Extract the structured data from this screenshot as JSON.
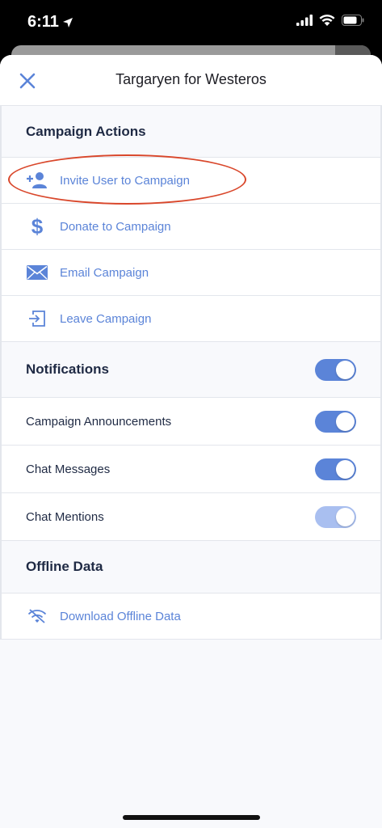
{
  "status_bar": {
    "time": "6:11",
    "location_icon": "location-arrow-icon",
    "signal_icon": "cellular-signal-icon",
    "wifi_icon": "wifi-icon",
    "battery_icon": "battery-icon"
  },
  "nav": {
    "title": "Targaryen for Westeros",
    "close_icon": "close-icon"
  },
  "campaign_actions": {
    "header": "Campaign Actions",
    "items": [
      {
        "label": "Invite User to Campaign",
        "icon": "add-user-icon"
      },
      {
        "label": "Donate to Campaign",
        "icon": "dollar-icon"
      },
      {
        "label": "Email Campaign",
        "icon": "envelope-icon"
      },
      {
        "label": "Leave Campaign",
        "icon": "exit-icon"
      }
    ]
  },
  "notifications": {
    "header": "Notifications",
    "master_on": true,
    "items": [
      {
        "label": "Campaign Announcements",
        "on": true,
        "enabled": true
      },
      {
        "label": "Chat Messages",
        "on": true,
        "enabled": true
      },
      {
        "label": "Chat Mentions",
        "on": true,
        "enabled": false
      }
    ]
  },
  "offline_data": {
    "header": "Offline Data",
    "items": [
      {
        "label": "Download Offline Data",
        "icon": "offline-wifi-icon"
      }
    ]
  },
  "colors": {
    "accent": "#5b84d8",
    "toggle_disabled": "#a9bff0",
    "annotation": "#d9472b",
    "heading": "#1f2a44"
  }
}
